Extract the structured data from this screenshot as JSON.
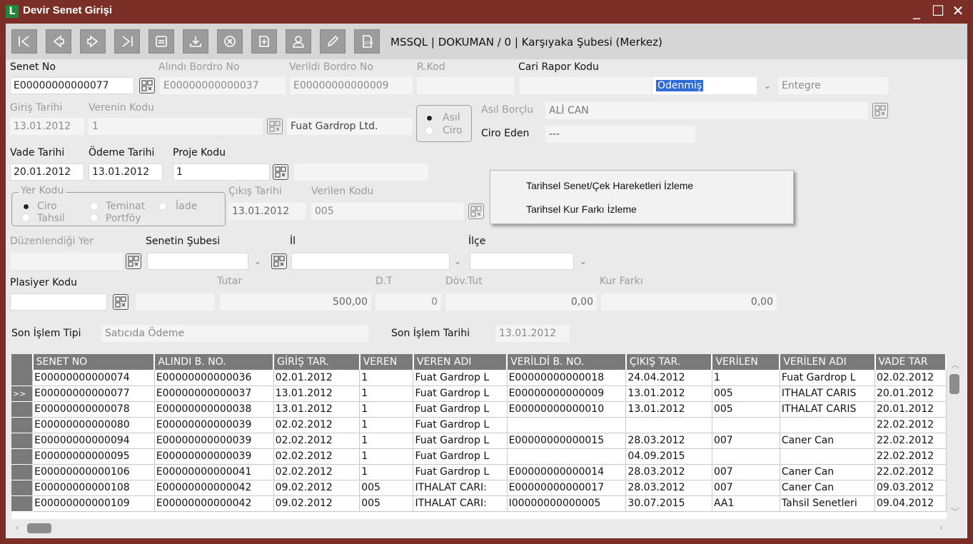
{
  "window": {
    "title": "Devir Senet Girişi",
    "logo": "L"
  },
  "toolbar": {
    "buttons": [
      "first-icon",
      "prev-icon",
      "next-icon",
      "last-icon",
      "list-icon",
      "download-icon",
      "cancel-icon",
      "add-doc-icon",
      "user-icon",
      "edit-icon",
      "log-icon"
    ],
    "log_label": "LOG",
    "info": "MSSQL | DOKUMAN / 0 | Karşıyaka Şubesi (Merkez)"
  },
  "form": {
    "senet_no_label": "Senet No",
    "senet_no": "E00000000000077",
    "alindi_label": "Alındı Bordro No",
    "alindi": "E00000000000037",
    "verildi_label": "Verildi Bordro No",
    "verildi": "E00000000000009",
    "rkod_label": "R.Kod",
    "rkod": "",
    "cari_rapor_label": "Cari Rapor Kodu",
    "cari_rapor": "",
    "durum": "Ödenmiş",
    "entegre": "Entegre",
    "giris_tarihi_label": "Giriş Tarihi",
    "giris_tarihi": "13.01.2012",
    "verenin_kodu_label": "Verenin Kodu",
    "verenin_kodu": "1",
    "veren_adi": "Fuat Gardrop Ltd.",
    "asil_label": "Asıl",
    "ciro_label": "Ciro",
    "asil_borclu_label": "Asıl Borçlu",
    "asil_borclu": "ALİ CAN",
    "ciro_eden_label": "Ciro Eden",
    "ciro_eden": "---",
    "vade_tarihi_label": "Vade Tarihi",
    "vade_tarihi": "20.01.2012",
    "odeme_tarihi_label": "Ödeme Tarihi",
    "odeme_tarihi": "13.01.2012",
    "proje_kodu_label": "Proje Kodu",
    "proje_kodu": "1",
    "proje_adi": "",
    "yer_kodu_label": "Yer Kodu",
    "yer_ciro": "Ciro",
    "yer_tahsil": "Tahsil",
    "yer_teminat": "Teminat",
    "yer_portfoy": "Portföy",
    "yer_iade": "İade",
    "cikis_tarihi_label": "Çıkış Tarihi",
    "cikis_tarihi": "13.01.2012",
    "verilen_kodu_label": "Verilen Kodu",
    "verilen_kodu": "005",
    "duzenlendigi_yer_label": "Düzenlendiği Yer",
    "senetin_subesi_label": "Senetin Şubesi",
    "il_label": "İl",
    "ilce_label": "İlçe",
    "plasiyer_kodu_label": "Plasiyer Kodu",
    "tutar_label": "Tutar",
    "tutar": "500,00",
    "dt_label": "D.T",
    "dt": "0",
    "dov_tut_label": "Döv.Tut",
    "dov_tut": "0,00",
    "kur_farki_label": "Kur Farkı",
    "kur_farki": "0,00",
    "son_islem_tipi_label": "Son İşlem Tipi",
    "son_islem_tipi": "Satıcıda Ödeme",
    "son_islem_tarihi_label": "Son İşlem Tarihi",
    "son_islem_tarihi": "13.01.2012"
  },
  "context_menu": {
    "items": [
      "Tarihsel Senet/Çek Hareketleri İzleme",
      "Tarihsel Kur Farkı İzleme"
    ]
  },
  "grid": {
    "columns": [
      "SENET NO",
      "ALINDI B. NO.",
      "GİRİŞ TAR.",
      "VEREN",
      "VEREN ADI",
      "VERİLDİ B. NO.",
      "ÇIKIŞ TAR.",
      "VERİLEN",
      "VERİLEN ADI",
      "VADE TAR"
    ],
    "current_marker": ">>",
    "rows": [
      [
        "E00000000000074",
        "E00000000000036",
        "02.01.2012",
        "1",
        "Fuat Gardrop L",
        "E00000000000018",
        "24.04.2012",
        "1",
        "Fuat Gardrop L",
        "02.02.2012"
      ],
      [
        "E00000000000077",
        "E00000000000037",
        "13.01.2012",
        "1",
        "Fuat Gardrop L",
        "E00000000000009",
        "13.01.2012",
        "005",
        "ITHALAT CARIS",
        "20.01.2012"
      ],
      [
        "E00000000000078",
        "E00000000000038",
        "13.01.2012",
        "1",
        "Fuat Gardrop L",
        "E00000000000010",
        "13.01.2012",
        "005",
        "ITHALAT CARIS",
        "20.01.2012"
      ],
      [
        "E00000000000080",
        "E00000000000039",
        "02.02.2012",
        "1",
        "Fuat Gardrop L",
        "",
        "",
        "",
        "",
        "22.02.2012"
      ],
      [
        "E00000000000094",
        "E00000000000039",
        "02.02.2012",
        "1",
        "Fuat Gardrop L",
        "E00000000000015",
        "28.03.2012",
        "007",
        "Caner Can",
        "22.02.2012"
      ],
      [
        "E00000000000095",
        "E00000000000039",
        "02.02.2012",
        "1",
        "Fuat Gardrop L",
        "",
        "04.09.2015",
        "",
        "",
        "22.02.2012"
      ],
      [
        "E00000000000106",
        "E00000000000041",
        "02.02.2012",
        "1",
        "Fuat Gardrop L",
        "E00000000000014",
        "28.03.2012",
        "007",
        "Caner Can",
        "22.02.2012"
      ],
      [
        "E00000000000108",
        "E00000000000042",
        "09.02.2012",
        "005",
        "ITHALAT CARI:",
        "E00000000000017",
        "28.03.2012",
        "007",
        "Caner Can",
        "09.03.2012"
      ],
      [
        "E00000000000109",
        "E00000000000042",
        "09.02.2012",
        "005",
        "ITHALAT CARI:",
        "I00000000000005",
        "30.07.2015",
        "AA1",
        "Tahsil Senetleri",
        "09.04.2012"
      ]
    ]
  }
}
